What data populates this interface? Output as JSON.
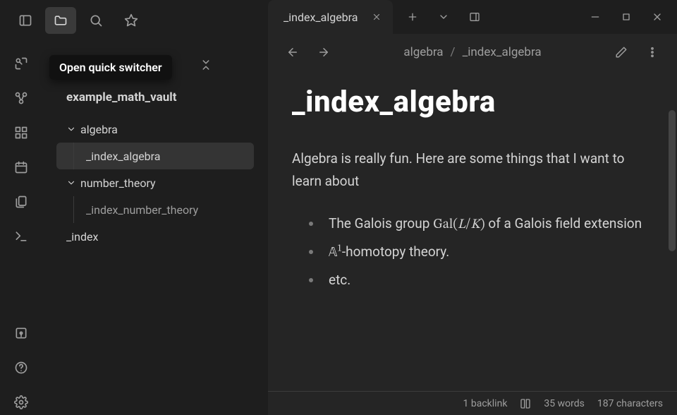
{
  "tooltip": "Open quick switcher",
  "top_icons": [
    {
      "name": "sidebar-toggle-icon"
    },
    {
      "name": "folder-icon",
      "active": true
    },
    {
      "name": "search-icon"
    },
    {
      "name": "bookmark-icon"
    }
  ],
  "ribbon": {
    "top": [
      {
        "name": "quick-switcher-icon"
      },
      {
        "name": "graph-icon"
      },
      {
        "name": "canvas-icon"
      },
      {
        "name": "daily-note-icon"
      },
      {
        "name": "templates-icon"
      },
      {
        "name": "command-palette-icon"
      }
    ],
    "bottom": [
      {
        "name": "vault-icon"
      },
      {
        "name": "help-icon"
      },
      {
        "name": "settings-icon"
      }
    ]
  },
  "sidebar": {
    "vault_title": "example_math_vault",
    "tree": [
      {
        "type": "folder",
        "label": "algebra"
      },
      {
        "type": "file",
        "label": "_index_algebra",
        "active": true
      },
      {
        "type": "folder",
        "label": "number_theory"
      },
      {
        "type": "file",
        "label": "_index_number_theory"
      },
      {
        "type": "root",
        "label": "_index"
      }
    ]
  },
  "tab": {
    "title": "_index_algebra"
  },
  "breadcrumb": {
    "parent": "algebra",
    "sep": "/",
    "current": "_index_algebra"
  },
  "note": {
    "title": "_index_algebra",
    "body": "Algebra is really fun. Here are some things that I want to learn about",
    "items": [
      {
        "pre": "The Galois group ",
        "math": "Gal(<span class='mi'>L</span>/<span class='mi'>K</span>)",
        "post": " of a Galois field extension"
      },
      {
        "pre": "",
        "math": "&#120120;<sup>1</sup>",
        "post": "-homotopy theory."
      },
      {
        "pre": "etc.",
        "math": "",
        "post": ""
      }
    ]
  },
  "status": {
    "backlinks": "1 backlink",
    "words": "35 words",
    "chars": "187 characters"
  }
}
